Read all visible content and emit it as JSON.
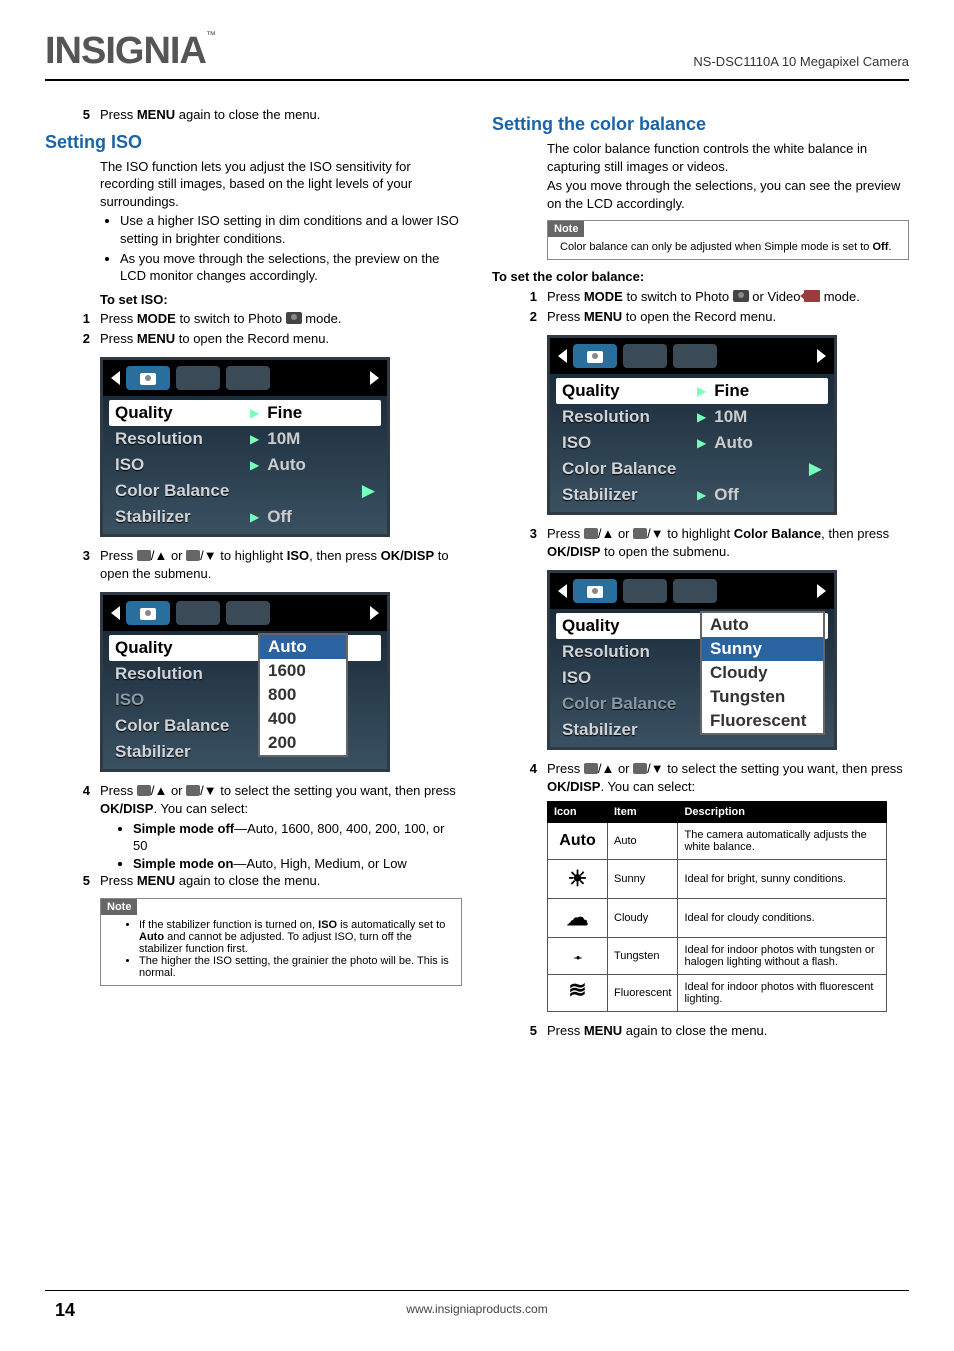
{
  "header": {
    "logo_text": "INSIGNIA",
    "logo_tm": "™",
    "product": "NS-DSC1110A 10 Megapixel Camera"
  },
  "left": {
    "step5_close": "Press ",
    "step5_close_b": "MENU",
    "step5_close_tail": " again to close the menu.",
    "h2_iso": "Setting ISO",
    "iso_intro": "The ISO function lets you adjust the ISO sensitivity for recording still images, based on the light levels of your surroundings.",
    "iso_bullets": [
      "Use a higher ISO setting in dim conditions and a lower ISO setting in brighter conditions.",
      "As you move through the selections, the preview on the LCD monitor changes accordingly."
    ],
    "h3_setiso": "To set ISO:",
    "s1_a": "Press ",
    "s1_b": "MODE",
    "s1_c": " to switch to Photo ",
    "s1_d": " mode.",
    "s2_a": "Press ",
    "s2_b": "MENU",
    "s2_c": " to open the Record menu.",
    "s3_a": "Press ",
    "s3_mid": " or ",
    "s3_b": " to highlight ",
    "s3_iso": "ISO",
    "s3_c": ", then press ",
    "s3_ok": "OK/DISP",
    "s3_d": " to open the submenu.",
    "s4_a": "Press ",
    "s4_mid": " or ",
    "s4_b": " to select the setting you want, then press ",
    "s4_ok": "OK/DISP",
    "s4_c": ". You can select:",
    "s4_opt1_b": "Simple mode off",
    "s4_opt1_t": "—Auto, 1600, 800, 400, 200, 100, or 50",
    "s4_opt2_b": "Simple mode on",
    "s4_opt2_t": "—Auto, High, Medium, or Low",
    "s5": "Press ",
    "s5_b": "MENU",
    "s5_t": " again to close the menu.",
    "note_label": "Note",
    "note_items": [
      {
        "pre": "If the stabilizer function is turned on, ",
        "b1": "ISO",
        "mid": " is automatically set to ",
        "b2": "Auto",
        "tail": " and cannot be adjusted. To adjust ISO, turn off the stabilizer function first."
      },
      {
        "pre": "The higher the ISO setting, the grainier the photo will be. This is normal.",
        "b1": "",
        "mid": "",
        "b2": "",
        "tail": ""
      }
    ],
    "menu1": {
      "rows": [
        {
          "label": "Quality",
          "val": "Fine",
          "hl": true,
          "side": false
        },
        {
          "label": "Resolution",
          "val": "10M",
          "hl": false,
          "side": false
        },
        {
          "label": "ISO",
          "val": "Auto",
          "hl": false,
          "side": false
        },
        {
          "label": "Color Balance",
          "val": "",
          "hl": false,
          "side": true
        },
        {
          "label": "Stabilizer",
          "val": "Off",
          "hl": false,
          "side": false
        }
      ]
    },
    "menu2": {
      "rows": [
        {
          "label": "Quality"
        },
        {
          "label": "Resolution"
        },
        {
          "label": "ISO",
          "dim": true
        },
        {
          "label": "Color Balance"
        },
        {
          "label": "Stabilizer"
        }
      ],
      "dropdown": [
        "Auto",
        "1600",
        "800",
        "400",
        "200"
      ]
    }
  },
  "right": {
    "h2_cb": "Setting the color balance",
    "cb_intro1": "The color balance function controls the white balance in capturing still images or videos.",
    "cb_intro2": "As you move through the selections, you can see the preview on the LCD accordingly.",
    "note_label": "Note",
    "note_text_a": "Color balance can only be adjusted when Simple mode is set to ",
    "note_text_b": "Off",
    "note_text_c": ".",
    "h3_setcb": "To set the color balance:",
    "s1_a": "Press ",
    "s1_b": "MODE",
    "s1_c": " to switch to Photo ",
    "s1_d": " or Video ",
    "s1_e": " mode.",
    "s2_a": "Press ",
    "s2_b": "MENU",
    "s2_c": " to open the Record menu.",
    "s3_a": "Press ",
    "s3_mid": " or ",
    "s3_b": " to highlight ",
    "s3_cb": "Color Balance",
    "s3_c": ", then press ",
    "s3_ok": "OK/DISP",
    "s3_d": " to open the submenu.",
    "s4_a": "Press ",
    "s4_mid": " or ",
    "s4_b": " to select the setting you want, then press ",
    "s4_ok": "OK/DISP",
    "s4_c": ". You can select:",
    "s5": "Press ",
    "s5_b": "MENU",
    "s5_t": " again to close the menu.",
    "menu1": {
      "rows": [
        {
          "label": "Quality",
          "val": "Fine",
          "hl": true
        },
        {
          "label": "Resolution",
          "val": "10M"
        },
        {
          "label": "ISO",
          "val": "Auto"
        },
        {
          "label": "Color Balance",
          "val": "",
          "side": true
        },
        {
          "label": "Stabilizer",
          "val": "Off"
        }
      ]
    },
    "menu2": {
      "rows": [
        {
          "label": "Quality"
        },
        {
          "label": "Resolution"
        },
        {
          "label": "ISO"
        },
        {
          "label": "Color Balance",
          "dim": true
        },
        {
          "label": "Stabilizer"
        }
      ],
      "dropdown": [
        "Auto",
        "Sunny",
        "Cloudy",
        "Tungsten",
        "Fluorescent"
      ],
      "dropdown_active_index": 1
    },
    "table": {
      "headers": [
        "Icon",
        "Item",
        "Description"
      ],
      "rows": [
        {
          "icon": "Auto",
          "item": "Auto",
          "desc": "The camera automatically adjusts the white balance."
        },
        {
          "icon": "sunny",
          "item": "Sunny",
          "desc": "Ideal for bright, sunny conditions."
        },
        {
          "icon": "cloudy",
          "item": "Cloudy",
          "desc": "Ideal for cloudy conditions."
        },
        {
          "icon": "tungsten",
          "item": "Tungsten",
          "desc": "Ideal for indoor photos with tungsten or halogen lighting without a flash."
        },
        {
          "icon": "fluorescent",
          "item": "Fluorescent",
          "desc": "Ideal for indoor photos with fluorescent lighting."
        }
      ]
    }
  },
  "footer": {
    "url": "www.insigniaproducts.com",
    "page": "14"
  }
}
